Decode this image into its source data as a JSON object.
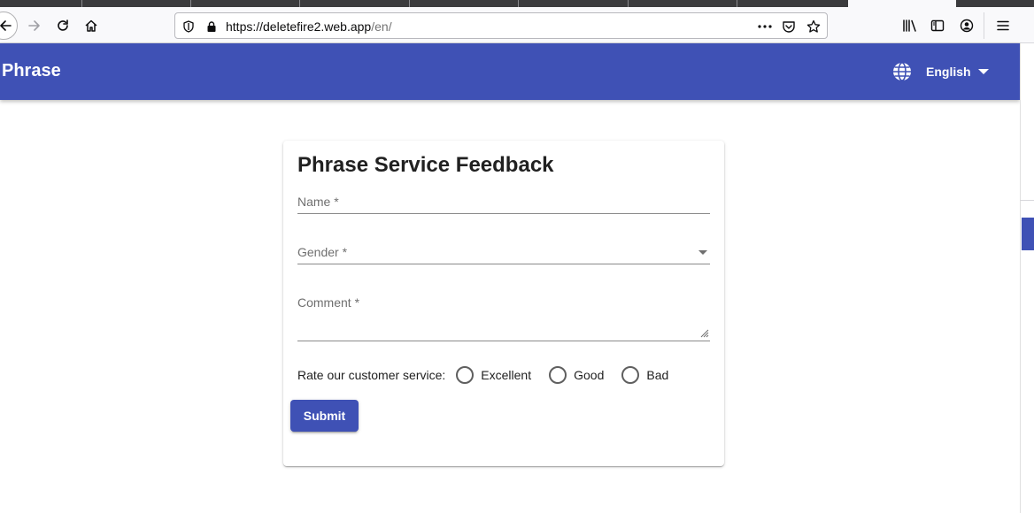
{
  "browser": {
    "url_host": "https://deletefire2.web.app",
    "url_path": "/en/"
  },
  "header": {
    "title": "Phrase",
    "language": "English",
    "color": "#3f51b5"
  },
  "form": {
    "title": "Phrase Service Feedback",
    "name_label": "Name *",
    "gender_label": "Gender *",
    "comment_label": "Comment *",
    "rating_label": "Rate our customer service:",
    "rating_options": [
      "Excellent",
      "Good",
      "Bad"
    ],
    "submit_label": "Submit"
  }
}
